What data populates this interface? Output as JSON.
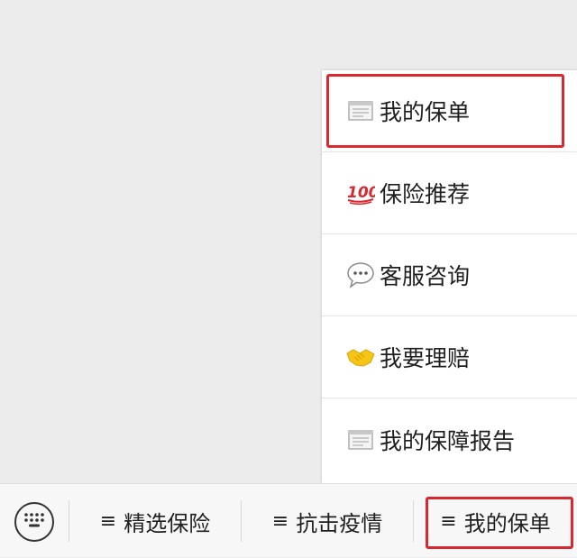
{
  "popup_menu": {
    "items": [
      {
        "label": "我的保单",
        "icon": "document-icon"
      },
      {
        "label": "保险推荐",
        "icon": "hundred-points-icon"
      },
      {
        "label": "客服咨询",
        "icon": "speech-bubble-icon"
      },
      {
        "label": "我要理赔",
        "icon": "handshake-icon"
      },
      {
        "label": "我的保障报告",
        "icon": "document-icon"
      }
    ],
    "highlighted_item": "我的保单"
  },
  "bottom_bar": {
    "keyboard_icon": "keyboard-icon",
    "tabs": [
      {
        "hamburger": "≡",
        "label": "精选保险"
      },
      {
        "hamburger": "≡",
        "label": "抗击疫情"
      },
      {
        "hamburger": "≡",
        "label": "我的保单"
      }
    ],
    "highlighted_tab": "我的保单"
  },
  "colors": {
    "highlight": "#d9282f",
    "background": "#ececec",
    "popup_background": "#ffffff",
    "bottom_bar_background": "#f7f7f7"
  }
}
